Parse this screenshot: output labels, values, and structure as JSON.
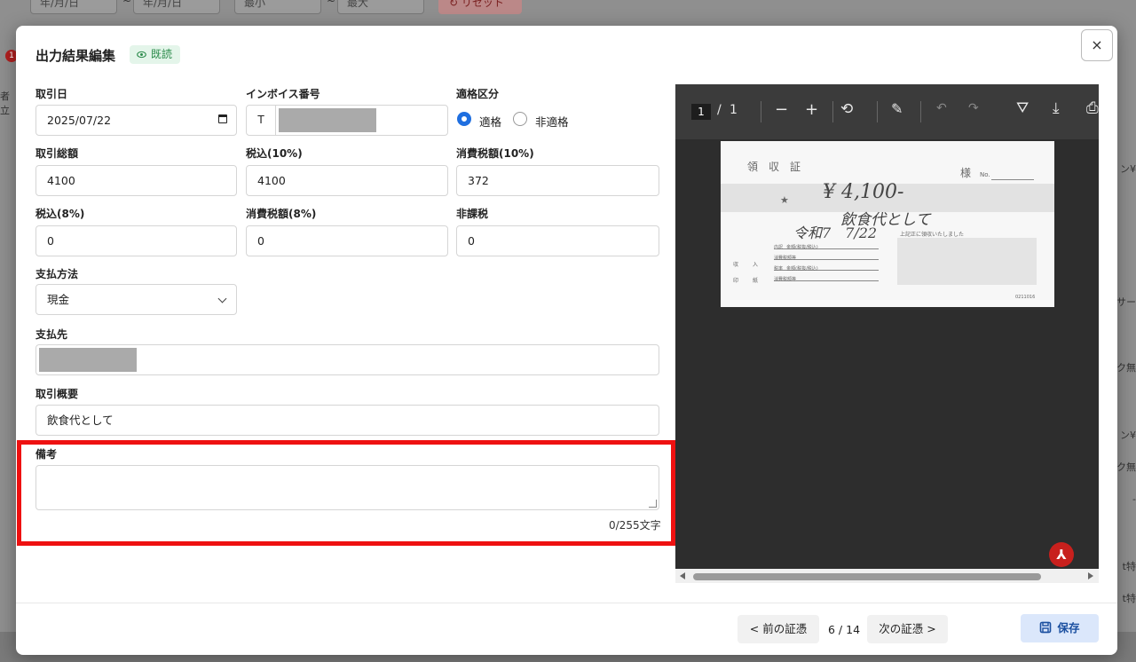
{
  "background": {
    "date_from_placeholder": "年/月/日",
    "date_to_placeholder": "年/月/日",
    "range_sep": "~",
    "min_placeholder": "最小",
    "max_placeholder": "最大",
    "reset_label": "リセット",
    "badge_count": "1",
    "left_col_header": "者立",
    "right_fragments": [
      "ン¥",
      "-サー",
      "ク無",
      "ン¥",
      "ク無",
      "-",
      "t特",
      "t特"
    ]
  },
  "modal": {
    "title": "出力結果編集",
    "status_badge": "既読",
    "close_label": "×"
  },
  "form": {
    "transaction_date": {
      "label": "取引日",
      "value": "2025/07/22"
    },
    "invoice_number": {
      "label": "インボイス番号",
      "prefix": "T",
      "value": ""
    },
    "eligibility": {
      "label": "適格区分",
      "options": [
        "適格",
        "非適格"
      ],
      "selected": "適格"
    },
    "total_amount": {
      "label": "取引総額",
      "value": "4100"
    },
    "tax_included_10": {
      "label": "税込(10%)",
      "value": "4100"
    },
    "tax_amount_10": {
      "label": "消費税額(10%)",
      "value": "372"
    },
    "tax_included_8": {
      "label": "税込(8%)",
      "value": "0"
    },
    "tax_amount_8": {
      "label": "消費税額(8%)",
      "value": "0"
    },
    "non_taxable": {
      "label": "非課税",
      "value": "0"
    },
    "payment_method": {
      "label": "支払方法",
      "value": "現金"
    },
    "payee": {
      "label": "支払先",
      "value": ""
    },
    "summary": {
      "label": "取引概要",
      "value": "飲食代として"
    },
    "remarks": {
      "label": "備考",
      "value": "",
      "counter": "0/255文字"
    }
  },
  "pdf": {
    "page_current": "1",
    "page_sep": "/",
    "page_total": "1",
    "receipt": {
      "title": "領　収　証",
      "addressee_suffix": "様",
      "no_label": "No.",
      "star": "★",
      "amount": "¥ 4,100-",
      "note": "飲食代として",
      "date": "令和7　7/22",
      "received_text": "上記正に領収いたしました",
      "items": [
        "内訳",
        "税抜",
        "金額(税抜/税込)",
        "消費税額等",
        "税率",
        "金額(税抜/税込)",
        "消費税額等"
      ],
      "stamp_labels": [
        "収",
        "入",
        "印",
        "紙"
      ],
      "code": "0211016"
    }
  },
  "footer": {
    "prev_label": "< 前の証憑",
    "pager": "6 / 14",
    "next_label": "次の証憑 >",
    "save_label": "保存"
  },
  "colors": {
    "accent": "#1f6fe0",
    "highlight": "#ee1111",
    "badge_bg": "#e4f5ea",
    "badge_text": "#2a8a4a",
    "save_bg": "#dbe7fb"
  }
}
